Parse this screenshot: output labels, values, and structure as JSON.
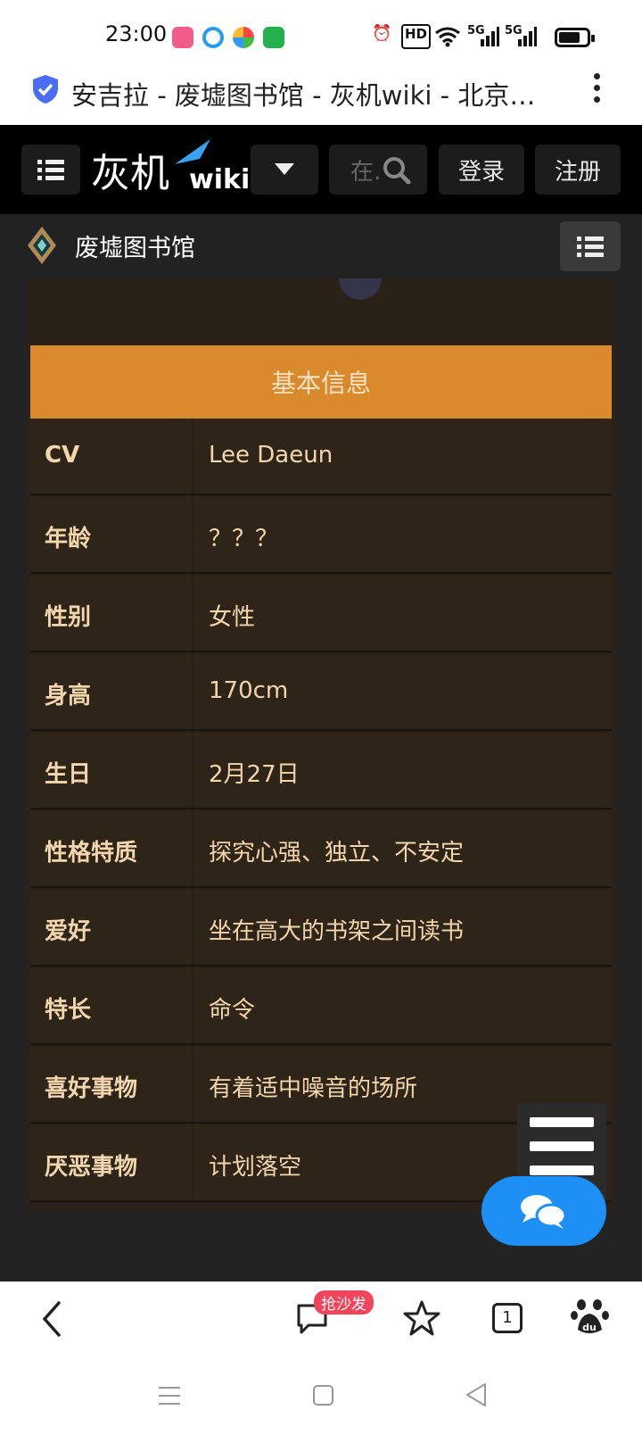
{
  "status_bar": {
    "time": "23:00",
    "icons": [
      "bilibili-app-icon",
      "quark-app-icon",
      "pinwheel-app-icon",
      "update-app-icon",
      "alarm-icon",
      "hd-icon",
      "wifi-icon",
      "5g-signal-icon",
      "5g-signal-icon",
      "battery-icon"
    ],
    "hd_label": "HD",
    "net1": "5G",
    "net2": "5G",
    "battery_level": 0.75
  },
  "browser": {
    "page_title": "安吉拉 - 废墟图书馆 - 灰机wiki - 北京…"
  },
  "site_nav": {
    "logo_text": "灰机",
    "logo_wiki": "wiki",
    "search_placeholder": "在.",
    "login": "登录",
    "register": "注册"
  },
  "sub_nav": {
    "wiki_name": "废墟图书馆"
  },
  "info_table": {
    "header": "基本信息",
    "rows": [
      {
        "key": "CV",
        "value": "Lee Daeun"
      },
      {
        "key": "年龄",
        "value": "？？？"
      },
      {
        "key": "性别",
        "value": "女性"
      },
      {
        "key": "身高",
        "value": "170cm"
      },
      {
        "key": "生日",
        "value": "2月27日"
      },
      {
        "key": "性格特质",
        "value": "探究心强、独立、不安定"
      },
      {
        "key": "爱好",
        "value": "坐在高大的书架之间读书"
      },
      {
        "key": "特长",
        "value": "命令"
      },
      {
        "key": "喜好事物",
        "value": "有着适中噪音的场所"
      },
      {
        "key": "厌恶事物",
        "value": "计划落空"
      }
    ]
  },
  "toolbar": {
    "comment_badge": "抢沙发",
    "tab_count": "1"
  },
  "colors": {
    "accent_orange": "#d88a2c",
    "table_bg": "#2f2418",
    "table_text": "#f2d6ad",
    "fab_blue": "#1e90f5",
    "badge_red": "#f0455a"
  }
}
